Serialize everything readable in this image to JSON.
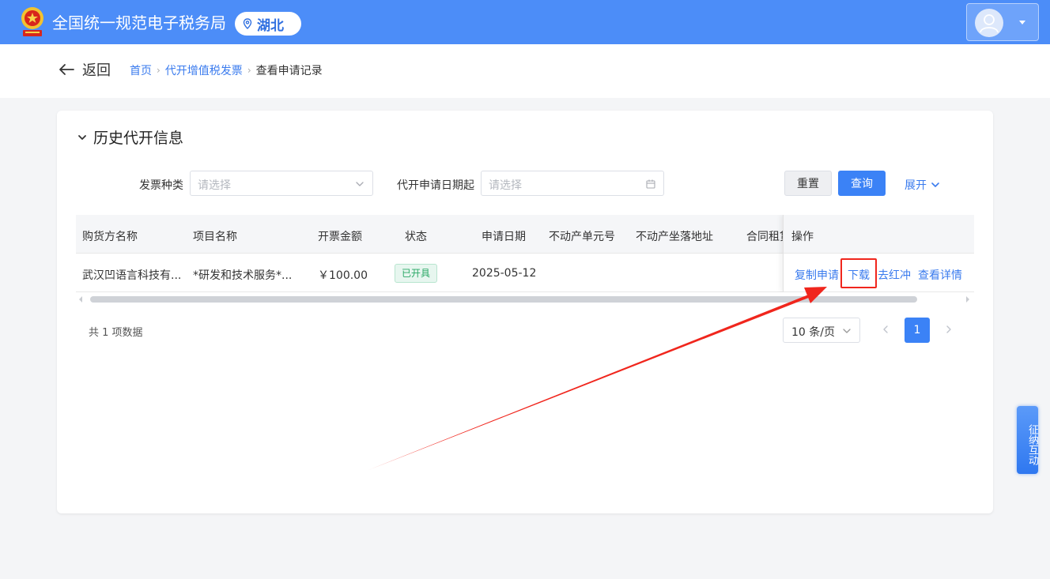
{
  "header": {
    "title": "全国统一规范电子税务局",
    "region": "湖北",
    "brand_color": "#4c8df8"
  },
  "nav": {
    "back_label": "返回",
    "breadcrumb": [
      "首页",
      "代开增值税发票",
      "查看申请记录"
    ]
  },
  "section": {
    "title": "历史代开信息"
  },
  "filters": {
    "invoice_type_label": "发票种类",
    "invoice_type_placeholder": "请选择",
    "date_label": "代开申请日期起",
    "date_placeholder": "请选择",
    "reset_label": "重置",
    "query_label": "查询",
    "expand_label": "展开"
  },
  "table": {
    "columns": [
      "购货方名称",
      "项目名称",
      "开票金额",
      "状态",
      "申请日期",
      "不动产单元号",
      "不动产坐落地址",
      "合同租赁",
      "操作"
    ],
    "rows": [
      {
        "buyer": "武汉凹语言科技有...",
        "item": "*研发和技术服务*...",
        "amount": "￥100.00",
        "status": "已开具",
        "date": "2025-05-12",
        "actions": [
          "复制申请",
          "下载",
          "去红冲",
          "查看详情"
        ]
      }
    ]
  },
  "pagination": {
    "total_text": "共 1 项数据",
    "page_size": "10 条/页",
    "current_page": "1"
  },
  "side_tab": {
    "label": "征纳互动"
  }
}
